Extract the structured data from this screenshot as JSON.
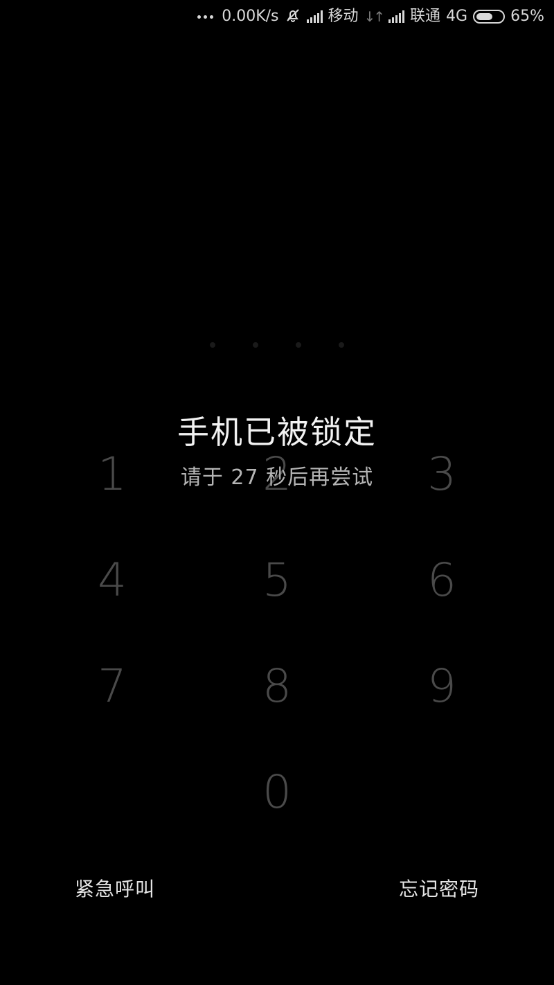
{
  "status_bar": {
    "speed": "0.00K/s",
    "carrier1": "移动",
    "carrier2": "联通",
    "network": "4G",
    "battery_text": "65%",
    "battery_level": 0.65,
    "icons": [
      "more-dots-icon",
      "mute-bell-icon",
      "signal-icon",
      "data-arrows-icon",
      "signal-icon",
      "battery-icon"
    ]
  },
  "lock": {
    "title": "手机已被锁定",
    "subtitle": "请于 27 秒后再尝试"
  },
  "keypad": {
    "keys": [
      "1",
      "2",
      "3",
      "4",
      "5",
      "6",
      "7",
      "8",
      "9",
      "0"
    ]
  },
  "actions": {
    "emergency_label": "紧急呼叫",
    "forgot_label": "忘记密码"
  }
}
